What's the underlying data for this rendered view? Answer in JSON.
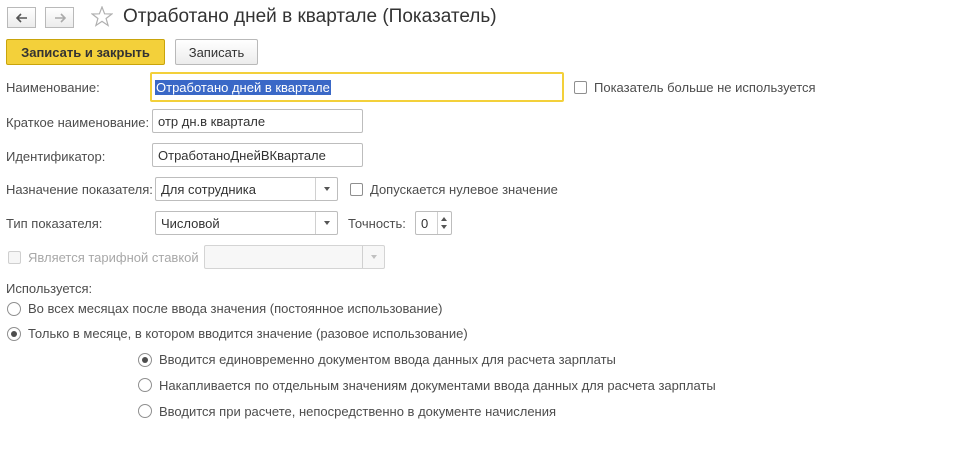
{
  "window": {
    "title": "Отработано дней в квартале (Показатель)"
  },
  "toolbar": {
    "save_close_label": "Записать и закрыть",
    "save_label": "Записать"
  },
  "form": {
    "name_label": "Наименование:",
    "name_value": "Отработано дней в квартале",
    "not_used_label": "Показатель больше не используется",
    "short_name_label": "Краткое наименование:",
    "short_name_value": "отр дн.в квартале",
    "id_label": "Идентификатор:",
    "id_value": "ОтработаноДнейВКвартале",
    "purpose_label": "Назначение показателя:",
    "purpose_value": "Для сотрудника",
    "zero_allowed_label": "Допускается нулевое значение",
    "type_label": "Тип показателя:",
    "type_value": "Числовой",
    "precision_label": "Точность:",
    "precision_value": "0",
    "tariff_label": "Является тарифной ставкой",
    "tariff_value": ""
  },
  "usage": {
    "label": "Используется:",
    "options": [
      "Во всех месяцах после ввода значения (постоянное использование)",
      "Только в месяце, в котором вводится значение (разовое использование)"
    ],
    "sub_options": [
      "Вводится единовременно документом ввода данных для расчета зарплаты",
      "Накапливается по отдельным значениям документами ввода данных для расчета зарплаты",
      "Вводится при расчете, непосредственно в документе начисления"
    ]
  },
  "colors": {
    "accent": "#f3d03a",
    "selection": "#3a68c7"
  }
}
